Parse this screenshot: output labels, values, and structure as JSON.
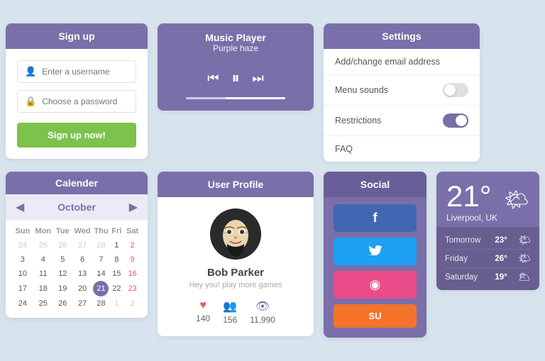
{
  "signup": {
    "header": "Sign up",
    "username_placeholder": "Enter a username",
    "password_placeholder": "Choose a password",
    "button_label": "Sign up now!"
  },
  "music": {
    "header": "Music Player",
    "subtitle": "Purple haze",
    "progress": 40
  },
  "settings": {
    "header": "Settings",
    "items": [
      {
        "id": "email",
        "label": "Add/change email address",
        "toggle": null
      },
      {
        "id": "sounds",
        "label": "Menu sounds",
        "toggle": "off"
      },
      {
        "id": "restrictions",
        "label": "Restrictions",
        "toggle": "on"
      },
      {
        "id": "faq",
        "label": "FAQ",
        "toggle": null
      }
    ]
  },
  "calendar": {
    "header": "Calender",
    "month": "October",
    "days_of_week": [
      "Sun",
      "Mon",
      "Tue",
      "Wed",
      "Thu",
      "Fri",
      "Sat"
    ],
    "weeks": [
      [
        {
          "d": "24",
          "m": "other"
        },
        {
          "d": "25",
          "m": "other"
        },
        {
          "d": "26",
          "m": "other"
        },
        {
          "d": "27",
          "m": "other"
        },
        {
          "d": "28",
          "m": "other"
        },
        {
          "d": "1",
          "m": "cur"
        },
        {
          "d": "2",
          "m": "cur",
          "sat": true
        }
      ],
      [
        {
          "d": "3",
          "m": "cur"
        },
        {
          "d": "4",
          "m": "cur"
        },
        {
          "d": "5",
          "m": "cur"
        },
        {
          "d": "6",
          "m": "cur"
        },
        {
          "d": "7",
          "m": "cur"
        },
        {
          "d": "8",
          "m": "cur"
        },
        {
          "d": "9",
          "m": "cur",
          "sat": true
        }
      ],
      [
        {
          "d": "10",
          "m": "cur"
        },
        {
          "d": "11",
          "m": "cur"
        },
        {
          "d": "12",
          "m": "cur"
        },
        {
          "d": "13",
          "m": "cur"
        },
        {
          "d": "14",
          "m": "cur"
        },
        {
          "d": "15",
          "m": "cur"
        },
        {
          "d": "16",
          "m": "cur",
          "sat": true
        }
      ],
      [
        {
          "d": "17",
          "m": "cur"
        },
        {
          "d": "18",
          "m": "cur"
        },
        {
          "d": "19",
          "m": "cur"
        },
        {
          "d": "20",
          "m": "cur"
        },
        {
          "d": "21",
          "m": "cur",
          "today": true
        },
        {
          "d": "22",
          "m": "cur"
        },
        {
          "d": "23",
          "m": "cur",
          "sat": true
        }
      ],
      [
        {
          "d": "24",
          "m": "cur"
        },
        {
          "d": "25",
          "m": "cur"
        },
        {
          "d": "26",
          "m": "cur"
        },
        {
          "d": "27",
          "m": "cur"
        },
        {
          "d": "28",
          "m": "cur"
        },
        {
          "d": "1",
          "m": "next"
        },
        {
          "d": "2",
          "m": "next"
        }
      ]
    ]
  },
  "profile": {
    "header": "User Profile",
    "name": "Bob Parker",
    "subtitle": "Hey you! play more games",
    "stats": [
      {
        "icon": "♥",
        "count": "140",
        "color": "#e55"
      },
      {
        "icon": "👥",
        "count": "156",
        "color": "#7b6faa"
      },
      {
        "icon": "👁",
        "count": "11,990",
        "color": "#7b6faa"
      }
    ]
  },
  "social": {
    "header": "Social",
    "buttons": [
      {
        "name": "facebook",
        "label": "f",
        "class": "fb"
      },
      {
        "name": "twitter",
        "label": "🐦",
        "class": "tw"
      },
      {
        "name": "dribbble",
        "label": "◉",
        "class": "dr"
      },
      {
        "name": "stumbleupon",
        "label": "su",
        "class": "su"
      }
    ]
  },
  "weather": {
    "temp": "21°",
    "location": "Liverpool, UK",
    "forecast": [
      {
        "day": "Tomorrow",
        "temp": "23°",
        "icon": "🌤"
      },
      {
        "day": "Friday",
        "temp": "26°",
        "icon": "🌤"
      },
      {
        "day": "Saturday",
        "temp": "19°",
        "icon": "🌥"
      }
    ]
  }
}
